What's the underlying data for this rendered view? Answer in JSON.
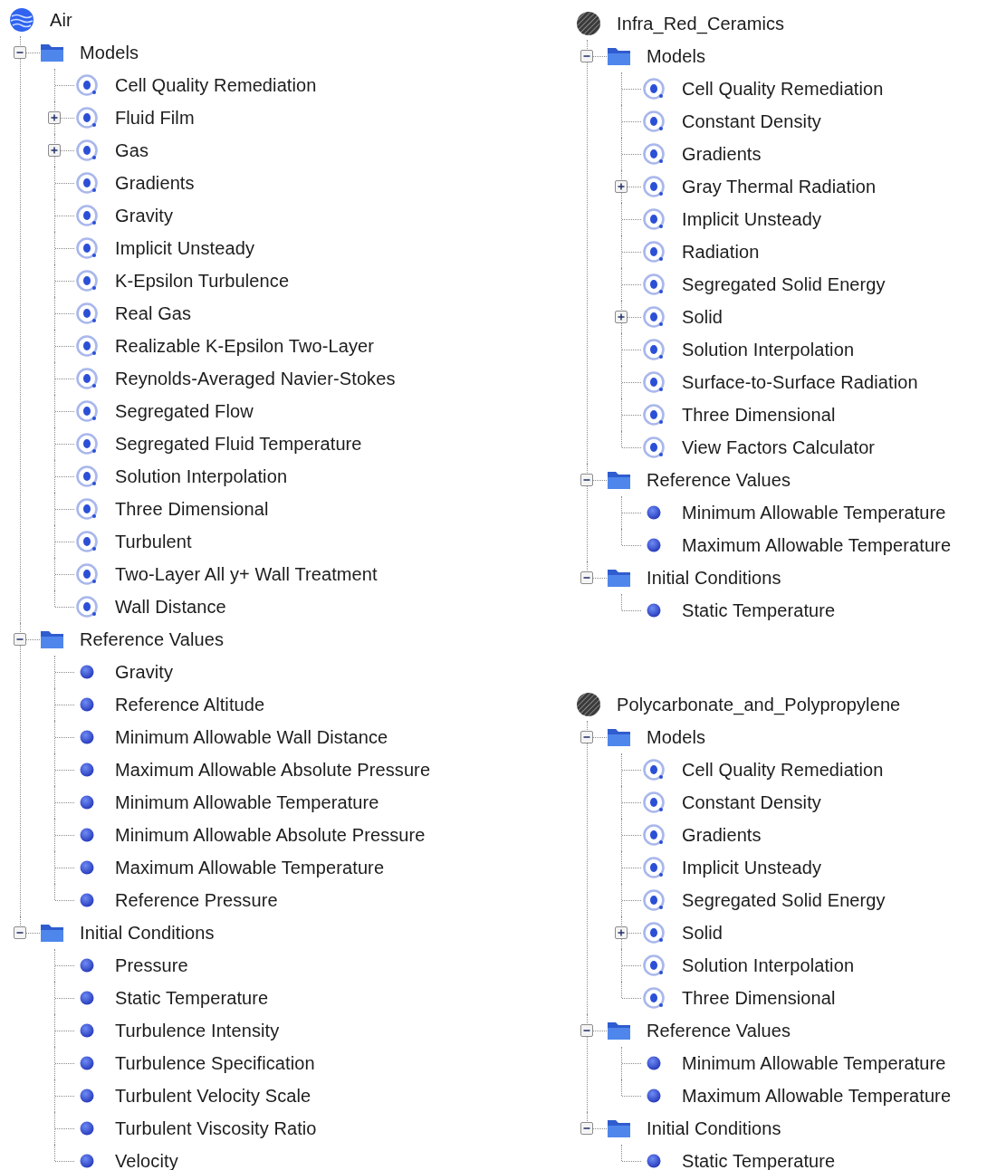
{
  "columns": [
    {
      "materials": [
        {
          "name": "Air",
          "kind": "fluid",
          "groups": [
            {
              "name": "Models",
              "expanded": true,
              "items": [
                {
                  "name": "Cell Quality Remediation",
                  "kind": "model"
                },
                {
                  "name": "Fluid Film",
                  "kind": "model",
                  "expanded": false
                },
                {
                  "name": "Gas",
                  "kind": "model",
                  "expanded": false
                },
                {
                  "name": "Gradients",
                  "kind": "model"
                },
                {
                  "name": "Gravity",
                  "kind": "model"
                },
                {
                  "name": "Implicit Unsteady",
                  "kind": "model"
                },
                {
                  "name": "K-Epsilon Turbulence",
                  "kind": "model"
                },
                {
                  "name": "Real Gas",
                  "kind": "model"
                },
                {
                  "name": "Realizable K-Epsilon Two-Layer",
                  "kind": "model"
                },
                {
                  "name": "Reynolds-Averaged Navier-Stokes",
                  "kind": "model"
                },
                {
                  "name": "Segregated Flow",
                  "kind": "model"
                },
                {
                  "name": "Segregated Fluid Temperature",
                  "kind": "model"
                },
                {
                  "name": "Solution Interpolation",
                  "kind": "model"
                },
                {
                  "name": "Three Dimensional",
                  "kind": "model"
                },
                {
                  "name": "Turbulent",
                  "kind": "model"
                },
                {
                  "name": "Two-Layer All y+ Wall Treatment",
                  "kind": "model"
                },
                {
                  "name": "Wall Distance",
                  "kind": "model"
                }
              ]
            },
            {
              "name": "Reference Values",
              "expanded": true,
              "items": [
                {
                  "name": "Gravity",
                  "kind": "value"
                },
                {
                  "name": "Reference Altitude",
                  "kind": "value"
                },
                {
                  "name": "Minimum Allowable Wall Distance",
                  "kind": "value"
                },
                {
                  "name": "Maximum Allowable Absolute Pressure",
                  "kind": "value"
                },
                {
                  "name": "Minimum Allowable Temperature",
                  "kind": "value"
                },
                {
                  "name": "Minimum Allowable Absolute Pressure",
                  "kind": "value"
                },
                {
                  "name": "Maximum Allowable Temperature",
                  "kind": "value"
                },
                {
                  "name": "Reference Pressure",
                  "kind": "value"
                }
              ]
            },
            {
              "name": "Initial Conditions",
              "expanded": true,
              "items": [
                {
                  "name": "Pressure",
                  "kind": "value"
                },
                {
                  "name": "Static Temperature",
                  "kind": "value"
                },
                {
                  "name": "Turbulence Intensity",
                  "kind": "value"
                },
                {
                  "name": "Turbulence Specification",
                  "kind": "value"
                },
                {
                  "name": "Turbulent Velocity Scale",
                  "kind": "value"
                },
                {
                  "name": "Turbulent Viscosity Ratio",
                  "kind": "value"
                },
                {
                  "name": "Velocity",
                  "kind": "value"
                }
              ]
            }
          ]
        }
      ]
    },
    {
      "materials": [
        {
          "name": "Infra_Red_Ceramics",
          "kind": "solid",
          "groups": [
            {
              "name": "Models",
              "expanded": true,
              "items": [
                {
                  "name": "Cell Quality Remediation",
                  "kind": "model"
                },
                {
                  "name": "Constant Density",
                  "kind": "model"
                },
                {
                  "name": "Gradients",
                  "kind": "model"
                },
                {
                  "name": "Gray Thermal Radiation",
                  "kind": "model",
                  "expanded": false
                },
                {
                  "name": "Implicit Unsteady",
                  "kind": "model"
                },
                {
                  "name": "Radiation",
                  "kind": "model"
                },
                {
                  "name": "Segregated Solid Energy",
                  "kind": "model"
                },
                {
                  "name": "Solid",
                  "kind": "model",
                  "expanded": false
                },
                {
                  "name": "Solution Interpolation",
                  "kind": "model"
                },
                {
                  "name": "Surface-to-Surface Radiation",
                  "kind": "model"
                },
                {
                  "name": "Three Dimensional",
                  "kind": "model"
                },
                {
                  "name": "View Factors Calculator",
                  "kind": "model"
                }
              ]
            },
            {
              "name": "Reference Values",
              "expanded": true,
              "items": [
                {
                  "name": "Minimum Allowable Temperature",
                  "kind": "value"
                },
                {
                  "name": "Maximum Allowable Temperature",
                  "kind": "value"
                }
              ]
            },
            {
              "name": "Initial Conditions",
              "expanded": true,
              "items": [
                {
                  "name": "Static Temperature",
                  "kind": "value"
                }
              ]
            }
          ]
        },
        {
          "name": "Polycarbonate_and_Polypropylene",
          "kind": "solid",
          "groups": [
            {
              "name": "Models",
              "expanded": true,
              "items": [
                {
                  "name": "Cell Quality Remediation",
                  "kind": "model"
                },
                {
                  "name": "Constant Density",
                  "kind": "model"
                },
                {
                  "name": "Gradients",
                  "kind": "model"
                },
                {
                  "name": "Implicit Unsteady",
                  "kind": "model"
                },
                {
                  "name": "Segregated Solid Energy",
                  "kind": "model"
                },
                {
                  "name": "Solid",
                  "kind": "model",
                  "expanded": false
                },
                {
                  "name": "Solution Interpolation",
                  "kind": "model"
                },
                {
                  "name": "Three Dimensional",
                  "kind": "model"
                }
              ]
            },
            {
              "name": "Reference Values",
              "expanded": true,
              "items": [
                {
                  "name": "Minimum Allowable Temperature",
                  "kind": "value"
                },
                {
                  "name": "Maximum Allowable Temperature",
                  "kind": "value"
                }
              ]
            },
            {
              "name": "Initial Conditions",
              "expanded": true,
              "items": [
                {
                  "name": "Static Temperature",
                  "kind": "value"
                }
              ]
            }
          ]
        }
      ]
    }
  ]
}
